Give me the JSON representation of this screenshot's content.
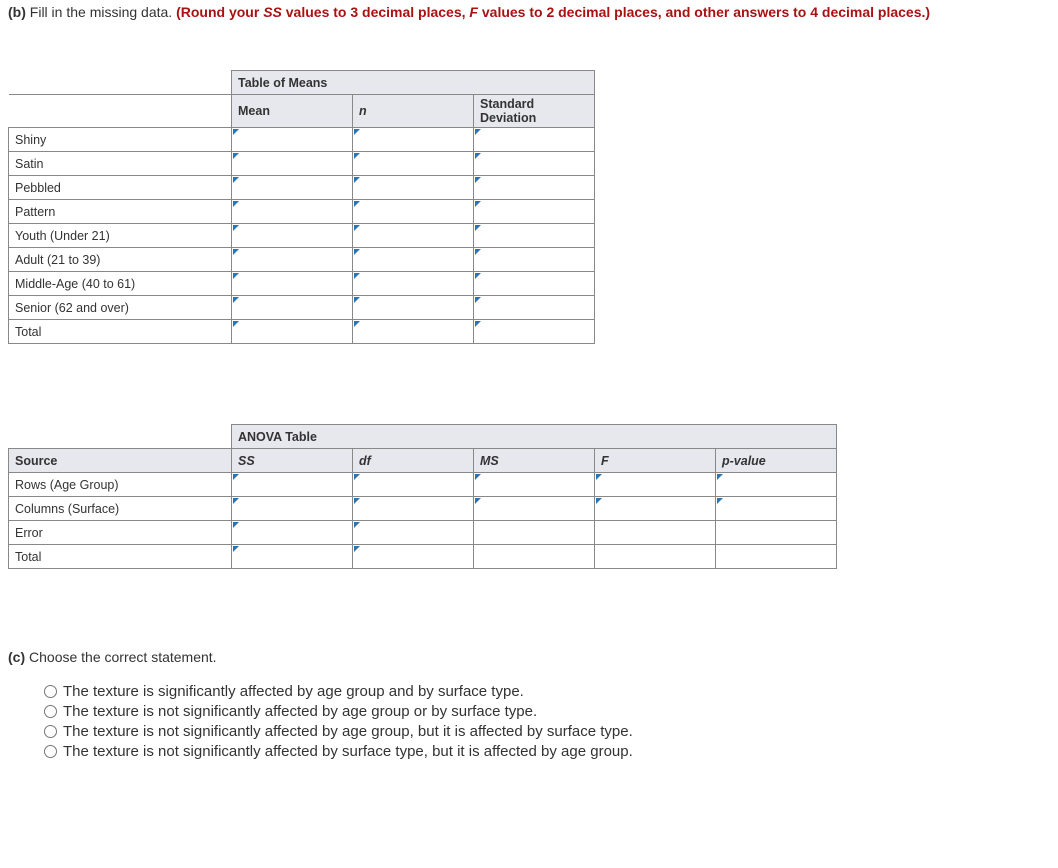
{
  "partB": {
    "label": "(b)",
    "text": "Fill in the missing data.",
    "hint_pre": "(Round your ",
    "hint_ss": "SS",
    "hint_mid1": " values to 3 decimal places, ",
    "hint_f": "F",
    "hint_mid2": " values to 2 decimal places, and other answers to 4 decimal places.)"
  },
  "meansTable": {
    "title": "Table of Means",
    "headers": {
      "mean": "Mean",
      "n": "n",
      "sd": "Standard Deviation"
    },
    "rows": [
      {
        "label": "Shiny"
      },
      {
        "label": "Satin"
      },
      {
        "label": "Pebbled"
      },
      {
        "label": "Pattern"
      },
      {
        "label": "Youth (Under 21)"
      },
      {
        "label": "Adult (21 to 39)"
      },
      {
        "label": "Middle-Age (40 to 61)"
      },
      {
        "label": "Senior (62 and over)"
      },
      {
        "label": "Total"
      }
    ]
  },
  "anovaTable": {
    "title": "ANOVA Table",
    "headers": {
      "source": "Source",
      "ss": "SS",
      "df": "df",
      "ms": "MS",
      "f": "F",
      "p": "p-value"
    },
    "rows": [
      {
        "label": "Rows (Age Group)",
        "cells": 5
      },
      {
        "label": "Columns (Surface)",
        "cells": 5
      },
      {
        "label": "Error",
        "cells": 2
      },
      {
        "label": "Total",
        "cells": 2
      }
    ]
  },
  "partC": {
    "label": "(c)",
    "text": "Choose the correct statement.",
    "options": [
      "The texture is significantly affected by age group and by surface type.",
      "The texture is not significantly affected by age group or by surface type.",
      "The texture is not significantly affected by age group, but it is affected by surface type.",
      "The texture is not significantly affected by surface type, but it is affected by age group."
    ]
  }
}
